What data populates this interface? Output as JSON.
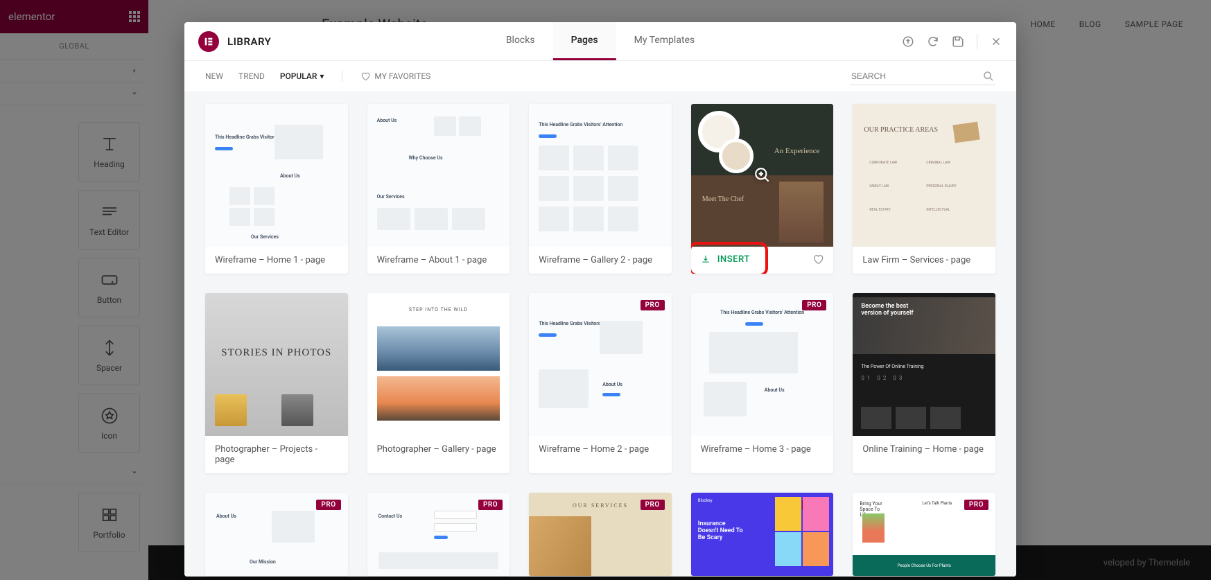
{
  "sidebar": {
    "brand": "elementor",
    "tab_global": "GLOBAL",
    "widgets": [
      {
        "name": "heading",
        "label": "Heading"
      },
      {
        "name": "text-editor",
        "label": "Text Editor"
      },
      {
        "name": "button",
        "label": "Button"
      },
      {
        "name": "spacer",
        "label": "Spacer"
      },
      {
        "name": "icon",
        "label": "Icon"
      },
      {
        "name": "portfolio",
        "label": "Portfolio"
      }
    ]
  },
  "page": {
    "title": "Example Website",
    "nav": [
      "HOME",
      "BLOG",
      "SAMPLE PAGE"
    ],
    "footer": "veloped by ThemeIsle"
  },
  "library": {
    "title": "LIBRARY",
    "tabs": [
      {
        "id": "blocks",
        "label": "Blocks",
        "active": false
      },
      {
        "id": "pages",
        "label": "Pages",
        "active": true
      },
      {
        "id": "my-templates",
        "label": "My Templates",
        "active": false
      }
    ],
    "filters": {
      "new": "NEW",
      "trend": "TREND",
      "popular": "POPULAR",
      "favorites": "MY FAVORITES"
    },
    "search_placeholder": "SEARCH",
    "insert_label": "INSERT",
    "pro_label": "PRO",
    "templates_row1": [
      {
        "id": "wf-home1",
        "title": "Wireframe – Home 1 - page",
        "pro": false,
        "kind": "wireframe"
      },
      {
        "id": "wf-about1",
        "title": "Wireframe – About 1 - page",
        "pro": false,
        "kind": "wireframe"
      },
      {
        "id": "wf-gallery2",
        "title": "Wireframe – Gallery 2 - page",
        "pro": false,
        "kind": "wireframe"
      },
      {
        "id": "restaurant",
        "title": "",
        "pro": false,
        "kind": "photo",
        "hovered": true
      },
      {
        "id": "law",
        "title": "Law Firm – Services - page",
        "pro": false,
        "kind": "law"
      }
    ],
    "templates_row2": [
      {
        "id": "photog-proj",
        "title": "Photographer – Projects - page",
        "pro": false,
        "kind": "photo-bw"
      },
      {
        "id": "photog-gal",
        "title": "Photographer – Gallery - page",
        "pro": false,
        "kind": "photo-nature"
      },
      {
        "id": "wf-home2",
        "title": "Wireframe – Home 2 - page",
        "pro": true,
        "kind": "wireframe"
      },
      {
        "id": "wf-home3",
        "title": "Wireframe – Home 3 - page",
        "pro": true,
        "kind": "wireframe"
      },
      {
        "id": "training",
        "title": "Online Training – Home - page",
        "pro": true,
        "kind": "fitness"
      }
    ],
    "templates_row3": [
      {
        "id": "wf-about2",
        "title": "",
        "pro": true,
        "kind": "wireframe-about"
      },
      {
        "id": "wf-contact",
        "title": "",
        "pro": true,
        "kind": "wireframe-contact"
      },
      {
        "id": "services",
        "title": "",
        "pro": true,
        "kind": "spa"
      },
      {
        "id": "insurance",
        "title": "",
        "pro": true,
        "kind": "insurance"
      },
      {
        "id": "plants",
        "title": "",
        "pro": true,
        "kind": "plants"
      }
    ],
    "thumb_text": {
      "wf_home1": {
        "headline": "This Headline Grabs Visitors' Attention",
        "about": "About Us",
        "services": "Our Services"
      },
      "wf_about1": {
        "about": "About Us",
        "why": "Why Choose Us",
        "services": "Our Services"
      },
      "wf_gallery2": {
        "headline": "This Headline Grabs Visitors' Attention"
      },
      "restaurant": {
        "t1": "An Experience",
        "t2": "Meet The Chef"
      },
      "law": {
        "title": "OUR PRACTICE AREAS",
        "c1": "CORPORATE LAW",
        "c2": "CRIMINAL LAW",
        "c3": "FAMILY LAW",
        "c4": "PERSONAL INJURY",
        "c5": "REAL ESTATE",
        "c6": "INTELLECTUAL"
      },
      "photog_proj": "STORIES IN PHOTOS",
      "photog_gal": "STEP INTO THE WILD",
      "wf_home2": {
        "headline": "This Headline Grabs Visitors' Attention",
        "about": "About Us"
      },
      "wf_home3": {
        "headline": "This Headline Grabs Visitors' Attention",
        "about": "About Us"
      },
      "training": {
        "t1": "Become the best version of yourself",
        "t2": "The Power Of Online Training",
        "nums": "01  02  03"
      },
      "wf_about2": {
        "about": "About Us",
        "mission": "Our Mission"
      },
      "wf_contact": {
        "contact": "Contact Us"
      },
      "spa": "OUR SERVICES",
      "insurance": {
        "brand": "Blocksy",
        "t": "Insurance Doesn't Need To Be Scary"
      },
      "plants": {
        "t1": "Bring Your Space To Life",
        "t2": "Let's Talk Plants",
        "t3": "People Choose Us For Plants"
      }
    }
  }
}
